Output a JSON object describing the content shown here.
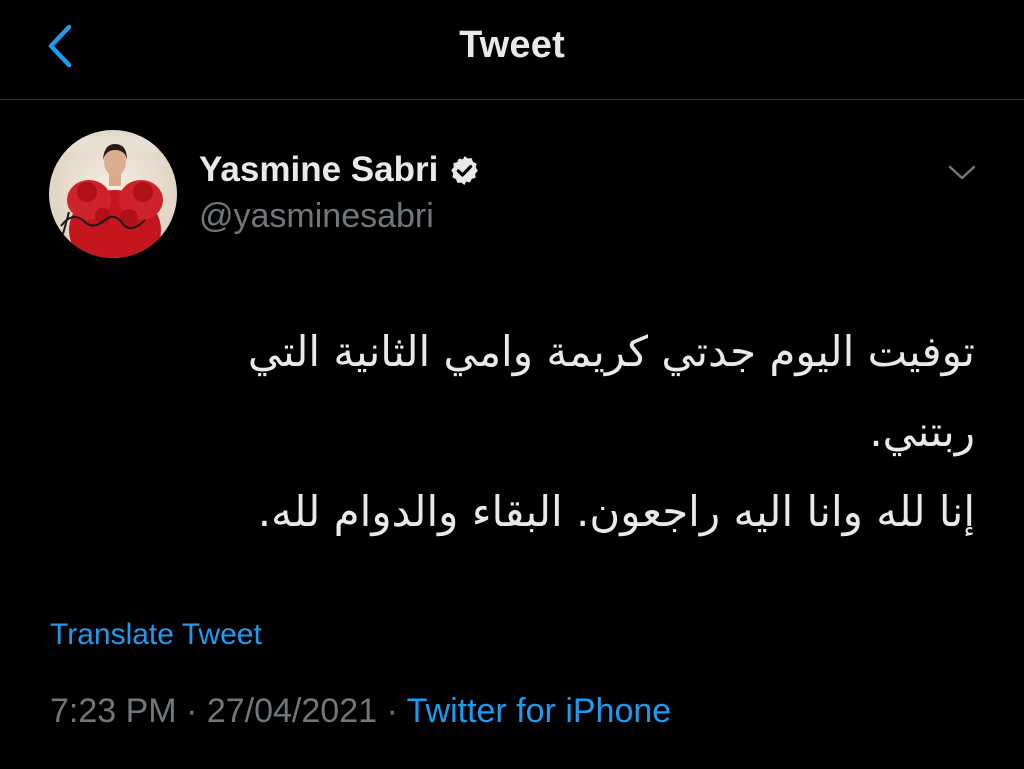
{
  "header": {
    "title": "Tweet",
    "back_icon": "chevron-left-icon"
  },
  "tweet": {
    "author": {
      "display_name": "Yasmine Sabri",
      "handle": "@yasminesabri",
      "verified": true
    },
    "text_lines": [
      "توفيت اليوم جدتي كريمة وامي الثانية التي ربتني.",
      "إنا لله وانا اليه راجعون. البقاء والدوام لله."
    ],
    "translate_label": "Translate Tweet",
    "time": "7:23 PM",
    "separator": " · ",
    "date": "27/04/2021",
    "source": "Twitter for iPhone"
  },
  "colors": {
    "background": "#000000",
    "text": "#e7e9ea",
    "muted": "#71767b",
    "accent": "#1d9bf0",
    "divider": "#2f3336"
  }
}
